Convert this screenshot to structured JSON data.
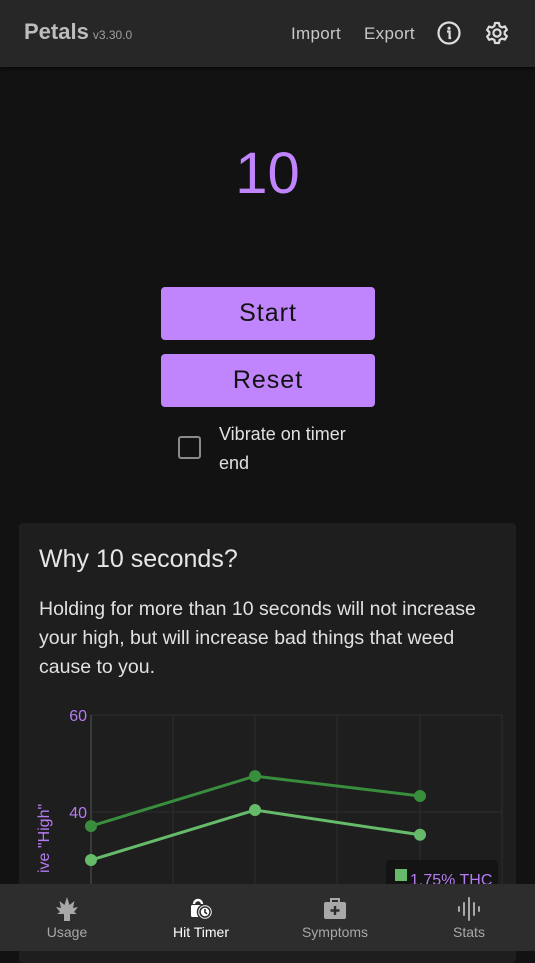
{
  "header": {
    "app_name": "Petals",
    "version": "v3.30.0",
    "import_label": "Import",
    "export_label": "Export",
    "info_icon": "info-icon",
    "settings_icon": "gear-icon"
  },
  "timer": {
    "value": "10",
    "start_label": "Start",
    "reset_label": "Reset",
    "vibrate_label": "Vibrate on timer end",
    "vibrate_checked": false
  },
  "card": {
    "title": "Why 10 seconds?",
    "body": "Holding for more than 10 seconds will not increase your high, but will increase bad things that weed cause to you."
  },
  "chart_data": {
    "type": "line",
    "ylabel": "ive \"High\"",
    "ytick_labels": [
      "60",
      "40"
    ],
    "ylim_visible": [
      30,
      60
    ],
    "grid": true,
    "legend": [
      "1.75% THC"
    ],
    "legend_placement": "bottom-right",
    "series": [
      {
        "color": "#388e3c",
        "values": [
          37.1,
          47.4,
          43.3
        ]
      },
      {
        "name": "1.75% THC",
        "color": "#66bb6a",
        "values": [
          30.1,
          40.4,
          35.3
        ]
      }
    ]
  },
  "nav": {
    "items": [
      {
        "label": "Usage",
        "icon": "cannabis-leaf-icon"
      },
      {
        "label": "Hit Timer",
        "icon": "timer-lock-icon",
        "active": true
      },
      {
        "label": "Symptoms",
        "icon": "medical-kit-icon"
      },
      {
        "label": "Stats",
        "icon": "waveform-icon"
      }
    ]
  },
  "colors": {
    "accent": "#c084fc",
    "background": "#121212",
    "appbar": "#272727"
  }
}
